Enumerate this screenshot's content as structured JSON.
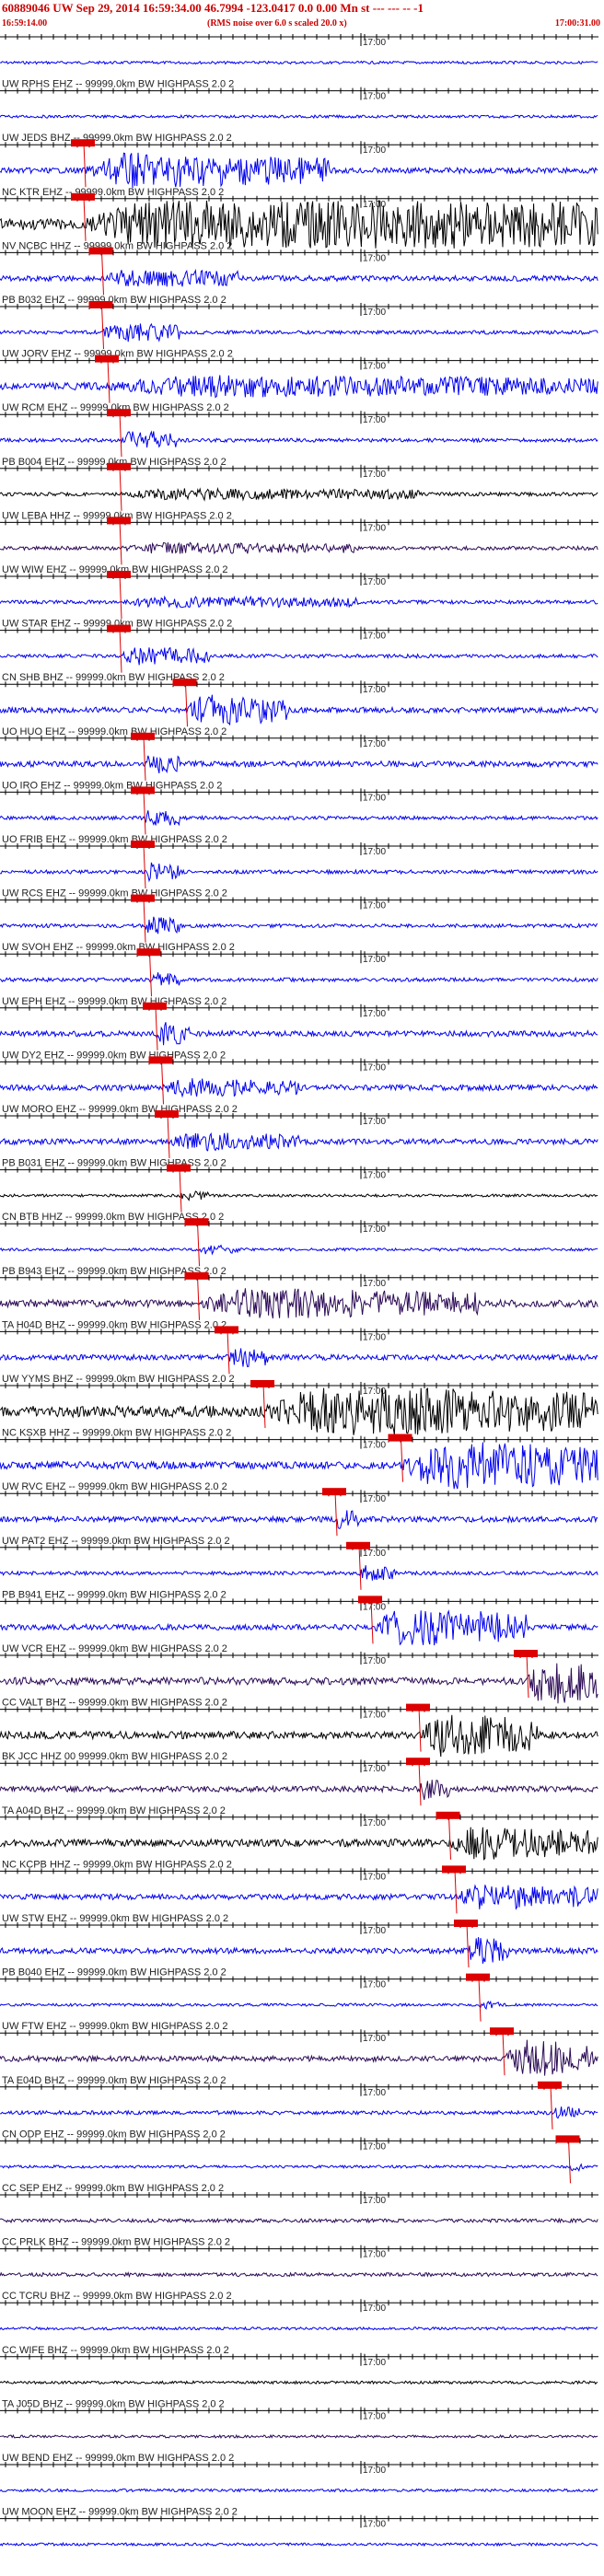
{
  "header": {
    "title": "60889046 UW Sep 29, 2014 16:59:34.00   46.7994 -123.0417  0.0 0.00 Mn st --- --- --   -1",
    "start_time": "16:59:14.00",
    "rms_note": "(RMS noise over 6.0 s scaled 20.0 x)",
    "end_time": "17:00:31.00"
  },
  "minute_mark": "17:00",
  "colors": {
    "blue": "#0000ee",
    "purple": "#2b0a55",
    "black": "#000000",
    "pick": "#dd0000",
    "axis": "#000000"
  },
  "traces": [
    {
      "label": "",
      "color": "blue",
      "amp": 1.5,
      "burst_start": 0.0,
      "burst_end": 0.0,
      "burst_amp": 0
    },
    {
      "label": "UW RPHS EHZ -- 99999.0km BW  HIGHPASS  2.0  2",
      "color": "blue",
      "amp": 1.5,
      "burst_start": 0.0,
      "burst_end": 0.0,
      "burst_amp": 0
    },
    {
      "label": "UW JEDS BHZ -- 99999.0km BW  HIGHPASS  2.0  2",
      "color": "blue",
      "amp": 3,
      "burst_start": 0.14,
      "burst_end": 0.55,
      "burst_amp": 18
    },
    {
      "label": "NC KTR EHZ -- 99999.0km BW  HIGHPASS  2.0  2",
      "color": "black",
      "amp": 6,
      "burst_start": 0.14,
      "burst_end": 1.0,
      "burst_amp": 30
    },
    {
      "label": "NV NCBC HHZ -- 99999.0km BW  HIGHPASS  2.0  2",
      "color": "blue",
      "amp": 3,
      "burst_start": 0.17,
      "burst_end": 0.4,
      "burst_amp": 8
    },
    {
      "label": "PB B032 EHZ -- 99999.0km BW  HIGHPASS  2.0  2",
      "color": "blue",
      "amp": 2,
      "burst_start": 0.17,
      "burst_end": 0.3,
      "burst_amp": 10
    },
    {
      "label": "UW JORV EHZ -- 99999.0km BW  HIGHPASS  2.0  2",
      "color": "blue",
      "amp": 4,
      "burst_start": 0.18,
      "burst_end": 1.0,
      "burst_amp": 9
    },
    {
      "label": "UW RCM EHZ -- 99999.0km BW  HIGHPASS  2.0  2",
      "color": "blue",
      "amp": 2,
      "burst_start": 0.2,
      "burst_end": 0.3,
      "burst_amp": 10
    },
    {
      "label": "PB B004 EHZ -- 99999.0km BW  HIGHPASS  2.0  2",
      "color": "black",
      "amp": 2,
      "burst_start": 0.2,
      "burst_end": 0.7,
      "burst_amp": 5
    },
    {
      "label": "UW LEBA HHZ -- 99999.0km BW  HIGHPASS  2.0  2",
      "color": "purple",
      "amp": 2,
      "burst_start": 0.2,
      "burst_end": 0.6,
      "burst_amp": 5
    },
    {
      "label": "UW WIW EHZ -- 99999.0km BW  HIGHPASS  2.0  2",
      "color": "blue",
      "amp": 2,
      "burst_start": 0.2,
      "burst_end": 0.6,
      "burst_amp": 5
    },
    {
      "label": "UW STAR EHZ -- 99999.0km BW  HIGHPASS  2.0  2",
      "color": "blue",
      "amp": 2,
      "burst_start": 0.2,
      "burst_end": 0.35,
      "burst_amp": 9
    },
    {
      "label": "CN SHB BHZ -- 99999.0km BW  HIGHPASS  2.0  2",
      "color": "blue",
      "amp": 3,
      "burst_start": 0.31,
      "burst_end": 0.48,
      "burst_amp": 16
    },
    {
      "label": "UO HUO EHZ -- 99999.0km BW  HIGHPASS  2.0  2",
      "color": "blue",
      "amp": 3,
      "burst_start": 0.24,
      "burst_end": 0.3,
      "burst_amp": 9
    },
    {
      "label": "UO IRO EHZ -- 99999.0km BW  HIGHPASS  2.0  2",
      "color": "blue",
      "amp": 2,
      "burst_start": 0.24,
      "burst_end": 0.3,
      "burst_amp": 9
    },
    {
      "label": "UO FRIB EHZ -- 99999.0km BW  HIGHPASS  2.0  2",
      "color": "blue",
      "amp": 2,
      "burst_start": 0.24,
      "burst_end": 0.3,
      "burst_amp": 9
    },
    {
      "label": "UW RCS EHZ -- 99999.0km BW  HIGHPASS  2.0  2",
      "color": "blue",
      "amp": 2,
      "burst_start": 0.24,
      "burst_end": 0.3,
      "burst_amp": 9
    },
    {
      "label": "UW SVOH EHZ -- 99999.0km BW  HIGHPASS  2.0  2",
      "color": "blue",
      "amp": 2,
      "burst_start": 0.25,
      "burst_end": 0.3,
      "burst_amp": 7
    },
    {
      "label": "UW EPH EHZ -- 99999.0km BW  HIGHPASS  2.0  2",
      "color": "blue",
      "amp": 3,
      "burst_start": 0.26,
      "burst_end": 0.32,
      "burst_amp": 12
    },
    {
      "label": "UW DY2 EHZ -- 99999.0km BW  HIGHPASS  2.0  2",
      "color": "blue",
      "amp": 3,
      "burst_start": 0.27,
      "burst_end": 0.5,
      "burst_amp": 8
    },
    {
      "label": "UW MORO EHZ -- 99999.0km BW  HIGHPASS  2.0  2",
      "color": "blue",
      "amp": 3,
      "burst_start": 0.28,
      "burst_end": 0.5,
      "burst_amp": 8
    },
    {
      "label": "PB B031 EHZ -- 99999.0km BW  HIGHPASS  2.0  2",
      "color": "black",
      "amp": 1.5,
      "burst_start": 0.3,
      "burst_end": 0.35,
      "burst_amp": 4
    },
    {
      "label": "CN BTB HHZ -- 99999.0km BW  HIGHPASS  2.0  2",
      "color": "blue",
      "amp": 1.5,
      "burst_start": 0.33,
      "burst_end": 0.4,
      "burst_amp": 4
    },
    {
      "label": "PB B943 EHZ -- 99999.0km BW  HIGHPASS  2.0  2",
      "color": "purple",
      "amp": 4,
      "burst_start": 0.33,
      "burst_end": 0.8,
      "burst_amp": 14
    },
    {
      "label": "TA H04D BHZ -- 99999.0km BW  HIGHPASS  2.0  2",
      "color": "blue",
      "amp": 3,
      "burst_start": 0.38,
      "burst_end": 0.45,
      "burst_amp": 9
    },
    {
      "label": "UW YYMS BHZ -- 99999.0km BW  HIGHPASS  2.0  2",
      "color": "black",
      "amp": 6,
      "burst_start": 0.44,
      "burst_end": 1.0,
      "burst_amp": 24
    },
    {
      "label": "NC KSXB HHZ -- 99999.0km BW  HIGHPASS  2.0  2",
      "color": "blue",
      "amp": 4,
      "burst_start": 0.67,
      "burst_end": 1.0,
      "burst_amp": 26
    },
    {
      "label": "UW RVC EHZ -- 99999.0km BW  HIGHPASS  2.0  2",
      "color": "blue",
      "amp": 3,
      "burst_start": 0.56,
      "burst_end": 0.6,
      "burst_amp": 9
    },
    {
      "label": "UW PAT2 EHZ -- 99999.0km BW  HIGHPASS  2.0  2",
      "color": "blue",
      "amp": 2,
      "burst_start": 0.6,
      "burst_end": 0.66,
      "burst_amp": 8
    },
    {
      "label": "PB B941 EHZ -- 99999.0km BW  HIGHPASS  2.0  2",
      "color": "blue",
      "amp": 3,
      "burst_start": 0.62,
      "burst_end": 0.88,
      "burst_amp": 20
    },
    {
      "label": "UW VCR EHZ -- 99999.0km BW  HIGHPASS  2.0  2",
      "color": "purple",
      "amp": 4,
      "burst_start": 0.88,
      "burst_end": 1.0,
      "burst_amp": 26
    },
    {
      "label": "CC VALT BHZ -- 99999.0km BW  HIGHPASS  2.0  2",
      "color": "black",
      "amp": 4,
      "burst_start": 0.7,
      "burst_end": 0.9,
      "burst_amp": 22
    },
    {
      "label": "BK JCC HHZ 00 99999.0km BW  HIGHPASS  2.0  2",
      "color": "purple",
      "amp": 3,
      "burst_start": 0.7,
      "burst_end": 0.75,
      "burst_amp": 10
    },
    {
      "label": "TA A04D BHZ -- 99999.0km BW  HIGHPASS  2.0  2",
      "color": "black",
      "amp": 4,
      "burst_start": 0.75,
      "burst_end": 1.0,
      "burst_amp": 16
    },
    {
      "label": "NC KCPB HHZ -- 99999.0km BW  HIGHPASS  2.0  2",
      "color": "blue",
      "amp": 3,
      "burst_start": 0.76,
      "burst_end": 1.0,
      "burst_amp": 12
    },
    {
      "label": "UW STW EHZ -- 99999.0km BW  HIGHPASS  2.0  2",
      "color": "blue",
      "amp": 3,
      "burst_start": 0.78,
      "burst_end": 0.85,
      "burst_amp": 14
    },
    {
      "label": "PB B040 EHZ -- 99999.0km BW  HIGHPASS  2.0  2",
      "color": "blue",
      "amp": 1.5,
      "burst_start": 0.8,
      "burst_end": 0.84,
      "burst_amp": 4
    },
    {
      "label": "UW FTW EHZ -- 99999.0km BW  HIGHPASS  2.0  2",
      "color": "purple",
      "amp": 3,
      "burst_start": 0.84,
      "burst_end": 1.0,
      "burst_amp": 20
    },
    {
      "label": "TA E04D BHZ -- 99999.0km BW  HIGHPASS  2.0  2",
      "color": "blue",
      "amp": 2,
      "burst_start": 0.92,
      "burst_end": 0.97,
      "burst_amp": 6
    },
    {
      "label": "CN ODP EHZ -- 99999.0km BW  HIGHPASS  2.0  2",
      "color": "blue",
      "amp": 1.5,
      "burst_start": 0.95,
      "burst_end": 0.98,
      "burst_amp": 4
    },
    {
      "label": "CC SEP EHZ -- 99999.0km BW  HIGHPASS  2.0  2",
      "color": "purple",
      "amp": 2,
      "burst_start": 0.0,
      "burst_end": 0.0,
      "burst_amp": 0
    },
    {
      "label": "CC PRLK BHZ -- 99999.0km BW  HIGHPASS  2.0  2",
      "color": "purple",
      "amp": 2,
      "burst_start": 0.0,
      "burst_end": 0.0,
      "burst_amp": 0
    },
    {
      "label": "CC TCRU BHZ -- 99999.0km BW  HIGHPASS  2.0  2",
      "color": "blue",
      "amp": 1.5,
      "burst_start": 0.0,
      "burst_end": 0.0,
      "burst_amp": 0
    },
    {
      "label": "CC WIFE BHZ -- 99999.0km BW  HIGHPASS  2.0  2",
      "color": "black",
      "amp": 1.5,
      "burst_start": 0.0,
      "burst_end": 0.0,
      "burst_amp": 0
    },
    {
      "label": "TA J05D BHZ -- 99999.0km BW  HIGHPASS  2.0  2",
      "color": "purple",
      "amp": 1.5,
      "burst_start": 0.0,
      "burst_end": 0.0,
      "burst_amp": 0
    },
    {
      "label": "UW BEND EHZ -- 99999.0km BW  HIGHPASS  2.0  2",
      "color": "blue",
      "amp": 1.5,
      "burst_start": 0.0,
      "burst_end": 0.0,
      "burst_amp": 0
    },
    {
      "label": "UW MOON EHZ -- 99999.0km BW  HIGHPASS  2.0  2",
      "color": "blue",
      "amp": 1.5,
      "burst_start": 0.0,
      "burst_end": 0.0,
      "burst_amp": 0
    }
  ]
}
